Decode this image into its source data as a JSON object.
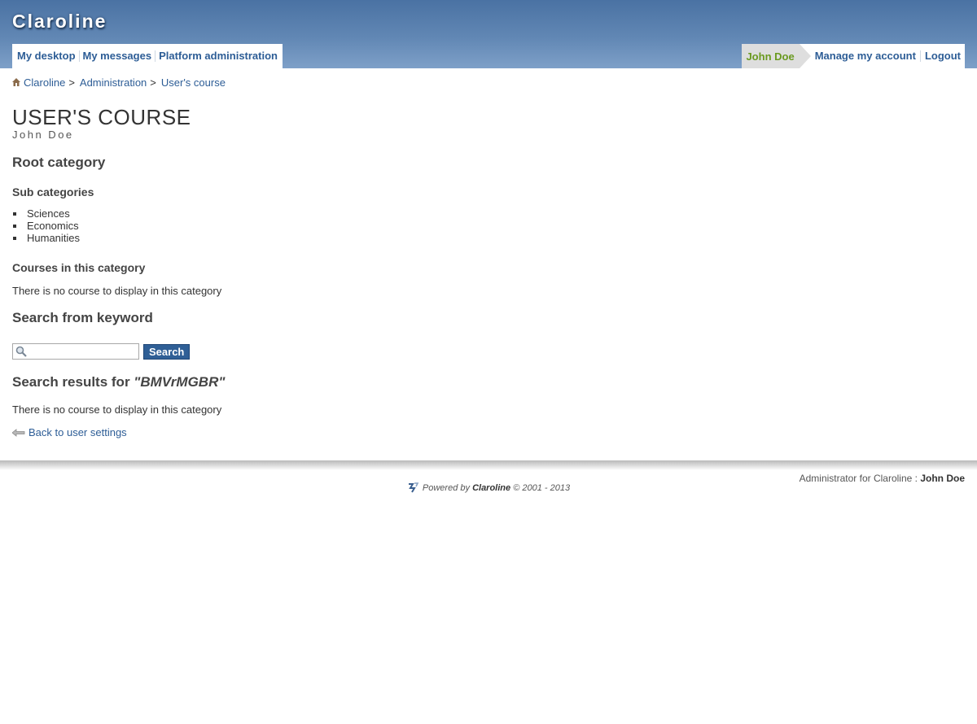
{
  "app": {
    "logo": "Claroline"
  },
  "nav": {
    "left": [
      "My desktop",
      "My messages",
      "Platform administration"
    ],
    "user": "John Doe",
    "right": [
      "Manage my account",
      "Logout"
    ]
  },
  "breadcrumb": {
    "items": [
      "Claroline",
      "Administration",
      "User's course"
    ],
    "separator": ">"
  },
  "page": {
    "title": "USER'S COURSE",
    "subtitle": "John Doe",
    "root_category": "Root category",
    "sub_categories_heading": "Sub categories",
    "sub_categories": [
      "Sciences",
      "Economics",
      "Humanities"
    ],
    "courses_heading": "Courses in this category",
    "no_course_msg": "There is no course to display in this category",
    "search_heading": "Search from keyword",
    "search_value": "",
    "search_button": "Search",
    "results_prefix": "Search results for ",
    "results_keyword": "\"BMVrMGBR\"",
    "no_result_msg": "There is no course to display in this category",
    "back_link": "Back to user settings"
  },
  "footer": {
    "admin_prefix": "Administrator for Claroline : ",
    "admin_name": "John Doe",
    "powered_prefix": "Powered by ",
    "powered_brand": "Claroline",
    "powered_suffix": " © 2001 - 2013"
  },
  "colors": {
    "header": "#4a72a3",
    "link": "#2d5d96",
    "user_tab_text": "#6a9a1f",
    "search_button": "#2f5f96"
  }
}
